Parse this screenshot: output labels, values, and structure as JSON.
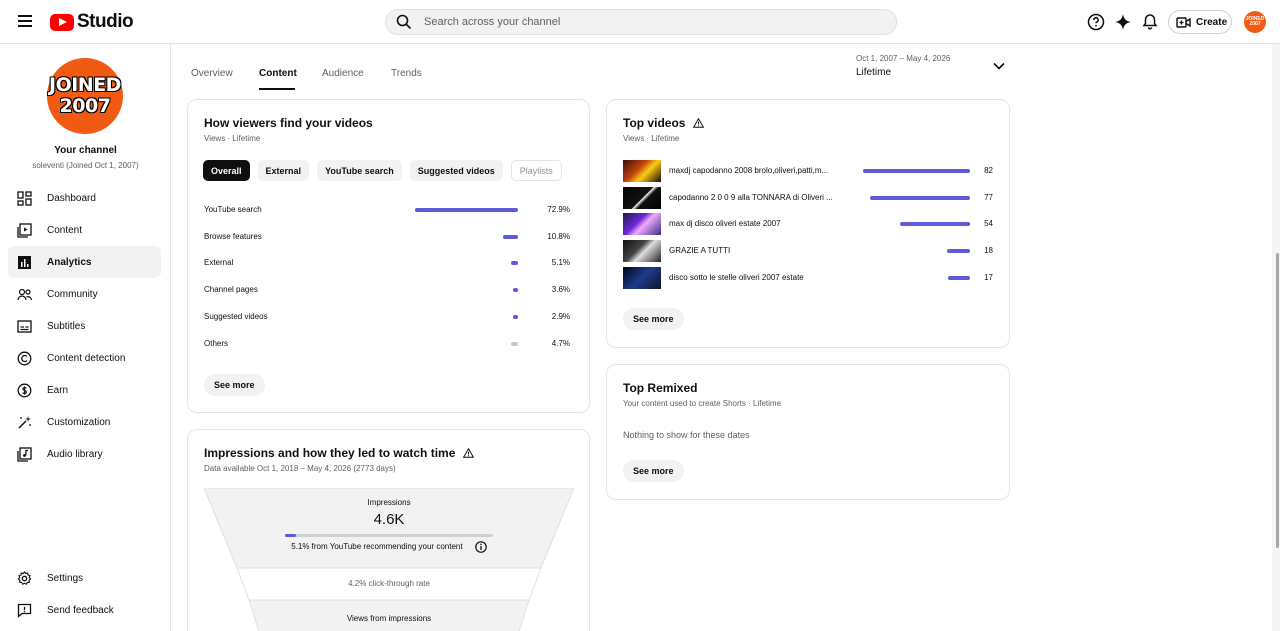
{
  "app": {
    "logo_text": "Studio",
    "search_placeholder": "Search across your channel",
    "create_label": "Create",
    "avatar_line1": "JOINED",
    "avatar_line2": "2007"
  },
  "channel": {
    "badge_line1": "JOINED",
    "badge_line2": "2007",
    "name": "Your channel",
    "subtitle": "soleventi (Joined Oct 1, 2007)"
  },
  "sidebar": {
    "items": [
      {
        "label": "Dashboard",
        "icon": "dashboard-icon"
      },
      {
        "label": "Content",
        "icon": "content-icon"
      },
      {
        "label": "Analytics",
        "icon": "analytics-icon",
        "active": true
      },
      {
        "label": "Community",
        "icon": "community-icon"
      },
      {
        "label": "Subtitles",
        "icon": "subtitles-icon"
      },
      {
        "label": "Content detection",
        "icon": "copyright-icon"
      },
      {
        "label": "Earn",
        "icon": "dollar-icon"
      },
      {
        "label": "Customization",
        "icon": "magic-wand-icon"
      },
      {
        "label": "Audio library",
        "icon": "audio-library-icon"
      }
    ],
    "bottom": [
      {
        "label": "Settings",
        "icon": "gear-icon"
      },
      {
        "label": "Send feedback",
        "icon": "feedback-icon"
      }
    ]
  },
  "tabs": [
    {
      "label": "Overview"
    },
    {
      "label": "Content",
      "active": true
    },
    {
      "label": "Audience"
    },
    {
      "label": "Trends"
    }
  ],
  "date_range": {
    "dates": "Oct 1, 2007 – May 4, 2026",
    "label": "Lifetime"
  },
  "traffic_card": {
    "title": "How viewers find your videos",
    "subtitle": "Views · Lifetime",
    "chips": [
      "Overall",
      "External",
      "YouTube search",
      "Suggested videos",
      "Playlists"
    ],
    "rows": [
      {
        "name": "YouTube search",
        "pct": "72.9%",
        "value": 72.9
      },
      {
        "name": "Browse features",
        "pct": "10.8%",
        "value": 10.8
      },
      {
        "name": "External",
        "pct": "5.1%",
        "value": 5.1
      },
      {
        "name": "Channel pages",
        "pct": "3.6%",
        "value": 3.6
      },
      {
        "name": "Suggested videos",
        "pct": "2.9%",
        "value": 2.9
      },
      {
        "name": "Others",
        "pct": "4.7%",
        "value": 4.7
      }
    ],
    "see_more": "See more"
  },
  "top_videos": {
    "title": "Top videos",
    "subtitle": "Views · Lifetime",
    "rows": [
      {
        "title": "maxdj capodanno 2008 brolo,oliveri,patti,m...",
        "views": "82",
        "value": 82
      },
      {
        "title": "capodanno 2 0 0 9 alla TONNARA di Oliveri ...",
        "views": "77",
        "value": 77
      },
      {
        "title": "max dj disco oliveri estate 2007",
        "views": "54",
        "value": 54
      },
      {
        "title": "GRAZIE A TUTTI",
        "views": "18",
        "value": 18
      },
      {
        "title": "disco sotto le stelle oliveri 2007 estate",
        "views": "17",
        "value": 17
      }
    ],
    "see_more": "See more"
  },
  "top_remixed": {
    "title": "Top Remixed",
    "subtitle": "Your content used to create Shorts · Lifetime",
    "empty_text": "Nothing to show for these dates",
    "see_more": "See more"
  },
  "impressions": {
    "title": "Impressions and how they led to watch time",
    "subtitle": "Data available Oct 1, 2018 – May 4, 2026 (2773 days)",
    "impressions_label": "Impressions",
    "impressions_value": "4.6K",
    "recommend_text": "5.1% from YouTube recommending your content",
    "recommend_value": 5.1,
    "ctr_text": "4.2% click-through rate",
    "views_label": "Views from impressions"
  },
  "colors": {
    "accent": "#5c5ad6",
    "brand_red": "#ff0000",
    "avatar_orange": "#f15a13"
  }
}
